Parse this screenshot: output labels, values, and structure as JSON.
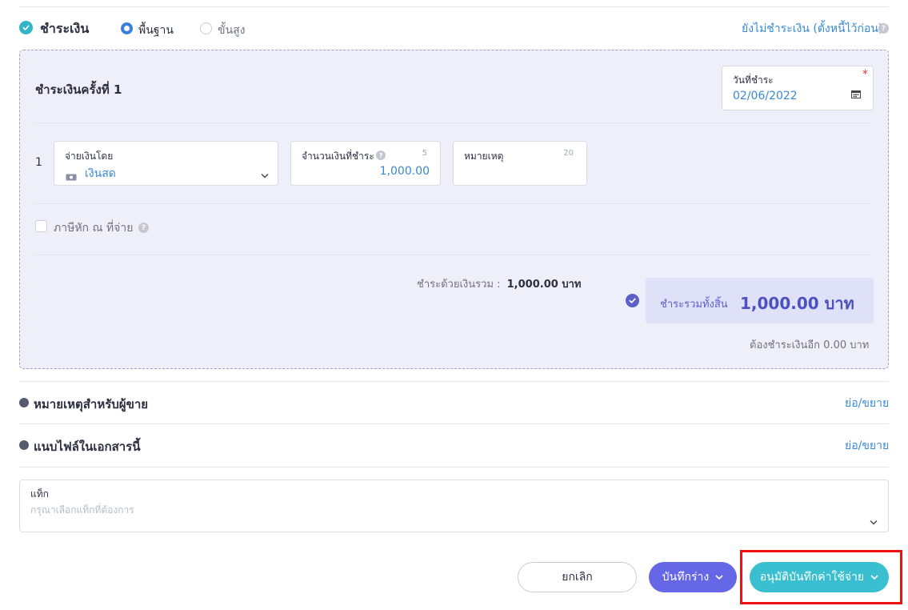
{
  "payment": {
    "title": "ชำระเงิน",
    "mode_basic": "พื้นฐาน",
    "mode_advanced": "ขั้นสูง",
    "unpaid_link": "ยังไม่ชำระเงิน (ตั้งหนี้ไว้ก่อน)",
    "installment_title": "ชำระเงินครั้งที่ 1",
    "date_label": "วันที่ชำระ",
    "date_value": "02/06/2022",
    "row_number": "1",
    "method_label": "จ่ายเงินโดย",
    "method_value": "เงินสด",
    "amount_label": "จำนวนเงินที่ชำระ",
    "amount_count": "5",
    "amount_value": "1,000.00",
    "note_label": "หมายเหตุ",
    "note_count": "20",
    "withholding_label": "ภาษีหัก ณ ที่จ่าย",
    "cash_total_label": "ชำระด้วยเงินรวม :",
    "cash_total_value": "1,000.00 บาท",
    "grand_total_label": "ชำระรวมทั้งสิ้น",
    "grand_total_value": "1,000.00 บาท",
    "remaining": "ต้องชำระเงินอีก 0.00 บาท"
  },
  "sections": {
    "seller_note": "หมายเหตุสำหรับผู้ขาย",
    "attachments": "แนบไฟล์ในเอกสารนี้",
    "toggle": "ย่อ/ขยาย"
  },
  "tags": {
    "label": "แท็ก",
    "placeholder": "กรุณาเลือกแท็กที่ต้องการ"
  },
  "actions": {
    "cancel": "ยกเลิก",
    "save_draft": "บันทึกร่าง",
    "approve": "อนุมัติบันทึกค่าใช้จ่าย"
  },
  "colors": {
    "accent": "#39bfcf",
    "draft": "#6667e6",
    "link": "#3a89d4",
    "highlight": "#ee1111"
  }
}
